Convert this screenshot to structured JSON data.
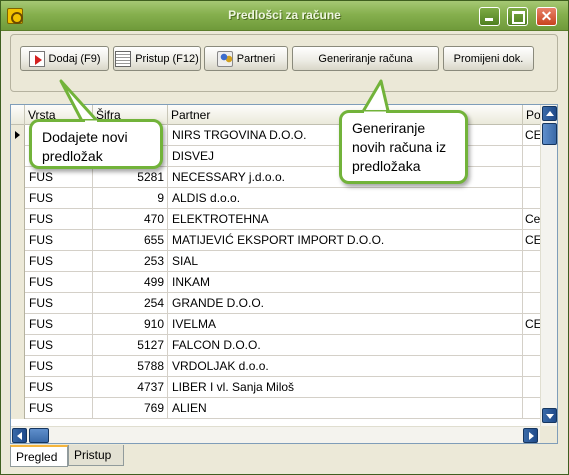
{
  "window": {
    "title": "Predlošci za račune",
    "controls": {
      "minimize": "minimize",
      "maximize": "maximize",
      "close": "✕"
    }
  },
  "toolbar": {
    "add_label": "Dodaj (F9)",
    "access_label": "Pristup (F12)",
    "partners_label": "Partneri",
    "generate_label": "Generiranje računa",
    "change_doc_label": "Promijeni dok."
  },
  "grid": {
    "columns": [
      "Vrsta",
      "Šifra",
      "Partner",
      "Po"
    ],
    "rows": [
      {
        "vrsta": "",
        "sifra": "",
        "partner": "NIRS TRGOVINA D.O.O.",
        "po": "CE",
        "selected": true
      },
      {
        "vrsta": "",
        "sifra": "",
        "partner": "DISVEJ",
        "po": ""
      },
      {
        "vrsta": "FUS",
        "sifra": "5281",
        "partner": "NECESSARY j.d.o.o.",
        "po": ""
      },
      {
        "vrsta": "FUS",
        "sifra": "9",
        "partner": "ALDIS d.o.o.",
        "po": ""
      },
      {
        "vrsta": "FUS",
        "sifra": "470",
        "partner": "ELEKTROTEHNA",
        "po": "Ce"
      },
      {
        "vrsta": "FUS",
        "sifra": "655",
        "partner": "MATIJEVIĆ EKSPORT IMPORT  D.O.O.",
        "po": "CE"
      },
      {
        "vrsta": "FUS",
        "sifra": "253",
        "partner": "SIAL",
        "po": ""
      },
      {
        "vrsta": "FUS",
        "sifra": "499",
        "partner": "INKAM",
        "po": ""
      },
      {
        "vrsta": "FUS",
        "sifra": "254",
        "partner": "GRANDE D.O.O.",
        "po": ""
      },
      {
        "vrsta": "FUS",
        "sifra": "910",
        "partner": "IVELMA",
        "po": "CE"
      },
      {
        "vrsta": "FUS",
        "sifra": "5127",
        "partner": "FALCON D.O.O.",
        "po": ""
      },
      {
        "vrsta": "FUS",
        "sifra": "5788",
        "partner": "VRDOLJAK d.o.o.",
        "po": ""
      },
      {
        "vrsta": "FUS",
        "sifra": "4737",
        "partner": "LIBER I vl. Sanja Miloš",
        "po": ""
      },
      {
        "vrsta": "FUS",
        "sifra": "769",
        "partner": "ALIEN",
        "po": ""
      }
    ]
  },
  "tabs": [
    {
      "label": "Pregled",
      "active": true
    },
    {
      "label": "Pristup",
      "active": false
    }
  ],
  "callouts": {
    "add_hint": "Dodajete novi predložak",
    "generate_hint": "Generiranje novih računa iz predložaka"
  },
  "colors": {
    "titlebar": "#86b04e",
    "callout_border": "#72b33a",
    "tab_accent": "#f5b53d",
    "scrollbar": "#3a6aa8"
  }
}
